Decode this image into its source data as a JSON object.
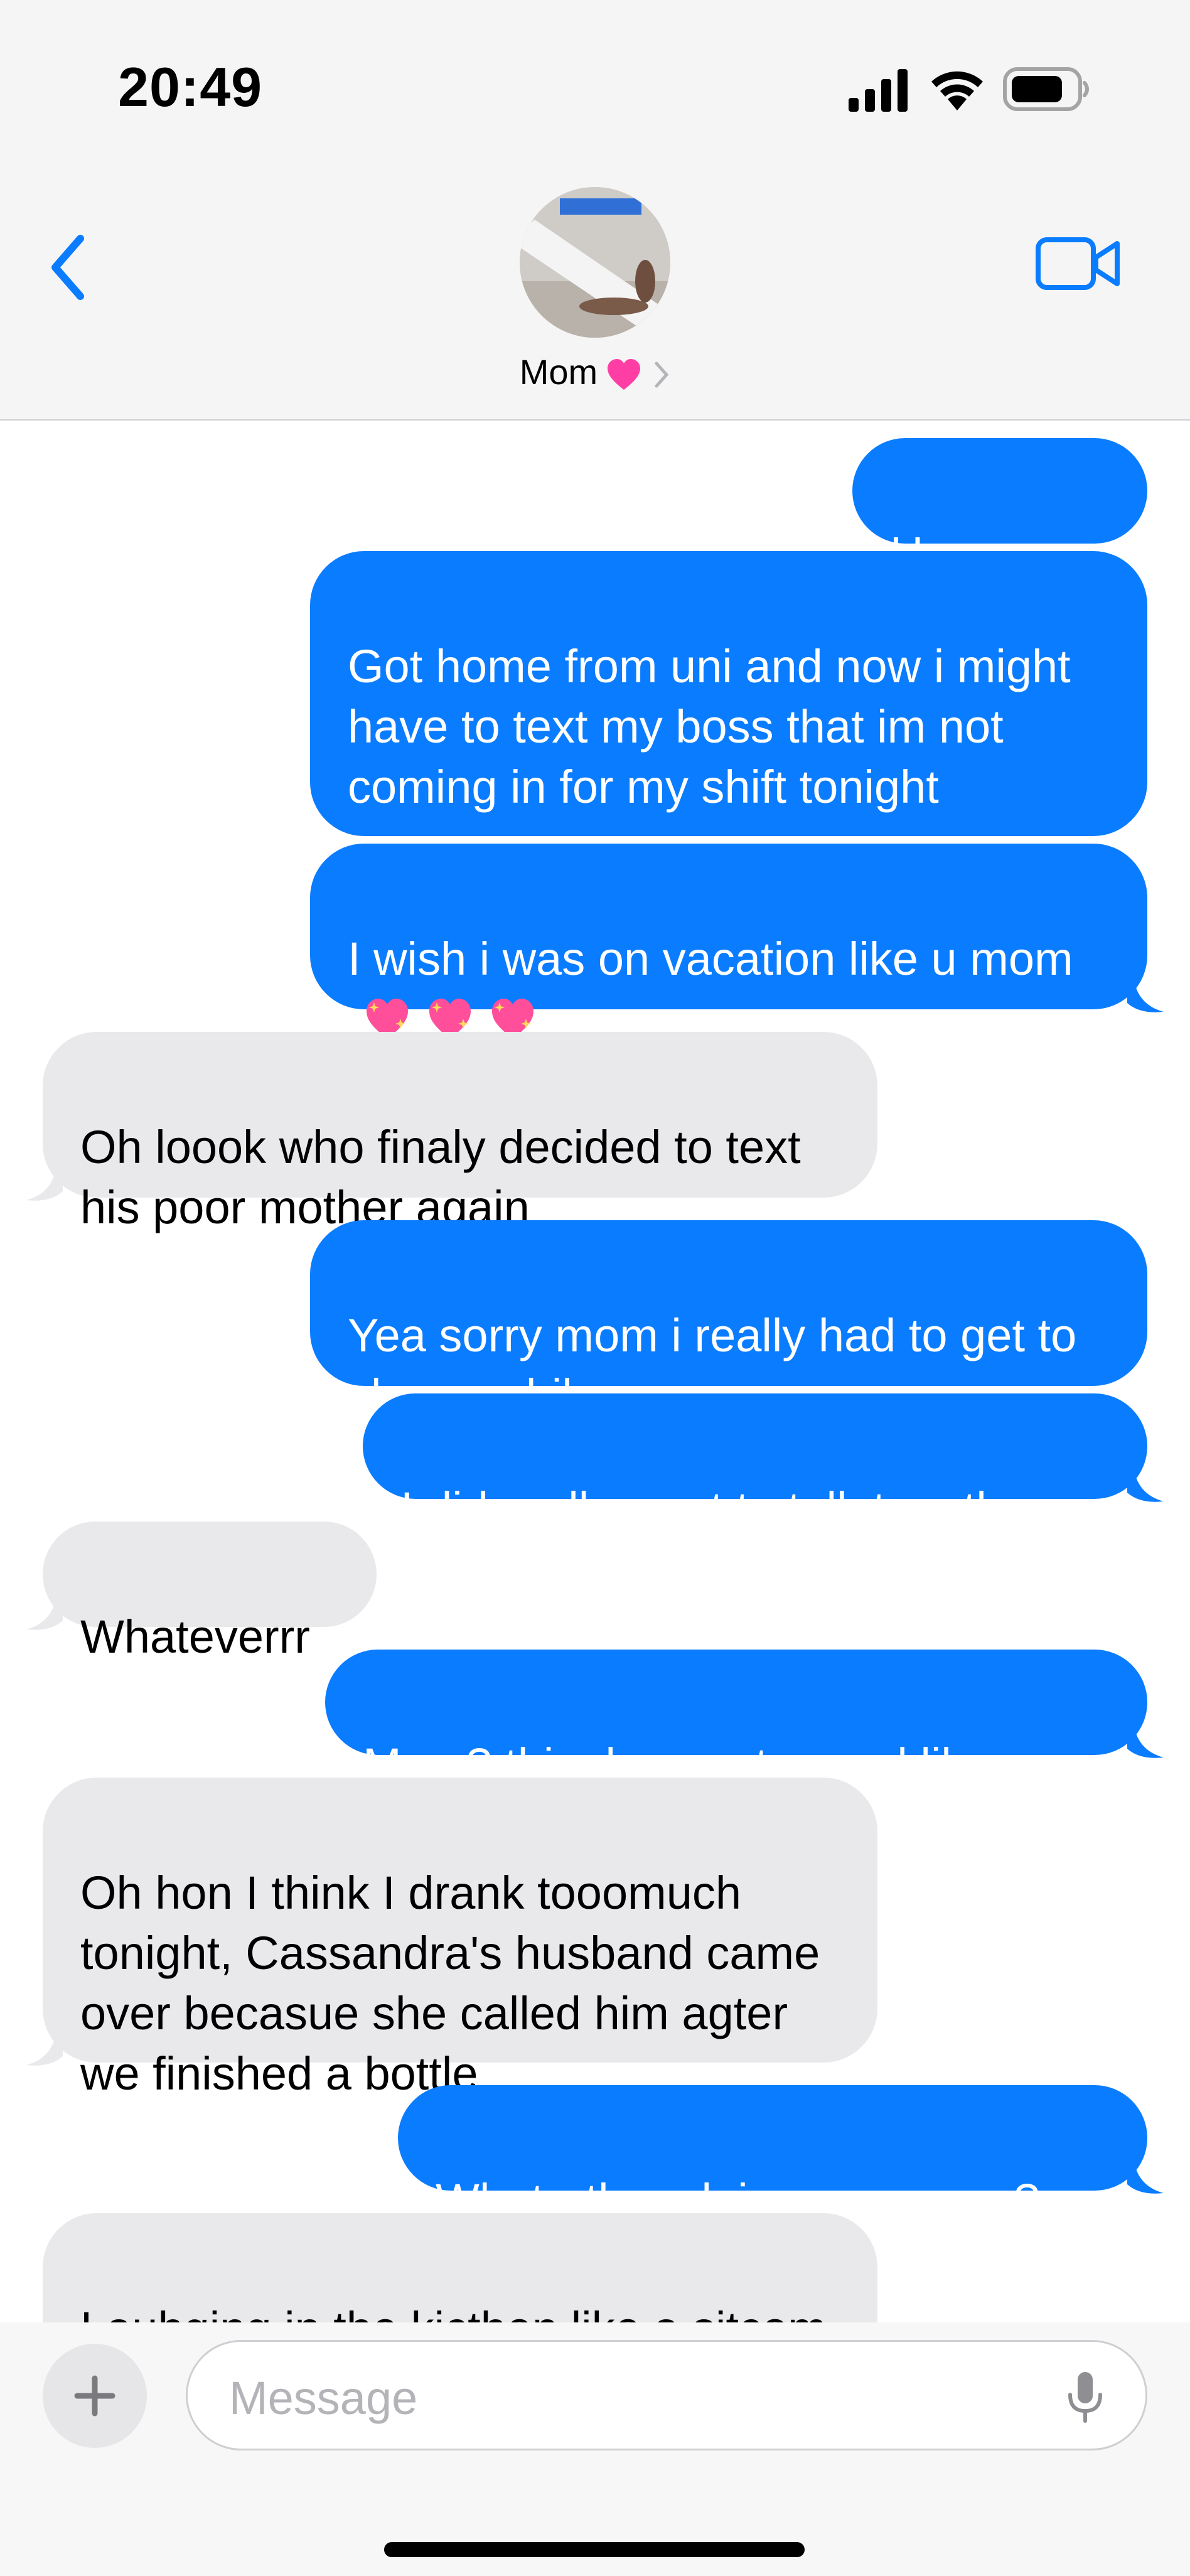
{
  "status_bar": {
    "time": "20:49"
  },
  "header": {
    "contact_name": "Mom",
    "icons": [
      "back-chevron-icon",
      "facetime-video-icon",
      "pink-heart-icon",
      "chevron-right-icon"
    ]
  },
  "messages": [
    {
      "dir": "sent",
      "text": "Hey mom"
    },
    {
      "dir": "sent",
      "text": "Got home from uni and now i might have to text my boss that im not coming in for my shift tonight"
    },
    {
      "dir": "sent",
      "text": "I wish i was on vacation like u mom",
      "emoji": [
        "sparkling-heart",
        "sparkling-heart",
        "sparkling-heart"
      ]
    },
    {
      "dir": "recv",
      "text": "Oh loook who finaly decided to text his poor mother again"
    },
    {
      "dir": "sent",
      "text": "Yea sorry mom i really had to get to class awhile ago"
    },
    {
      "dir": "sent",
      "text": "I did really want to talk to u tho"
    },
    {
      "dir": "recv",
      "text": "Whateverrr"
    },
    {
      "dir": "sent",
      "text": "Mom? this does not sound like u"
    },
    {
      "dir": "recv",
      "text": "Oh hon I think I drank tooomuch tonight, Cassandra's husband came over becasue she called him agter we finished a bottle"
    },
    {
      "dir": "sent",
      "text": "What r they doing now mom?"
    },
    {
      "dir": "recv",
      "text": "Lauhging in the kicthen like  a sitcom, its annoying"
    }
  ],
  "composer": {
    "placeholder": "Message"
  },
  "colors": {
    "sent_bubble": "#0a7cff",
    "recv_bubble": "#e9e9eb",
    "accent": "#0a7cff"
  }
}
